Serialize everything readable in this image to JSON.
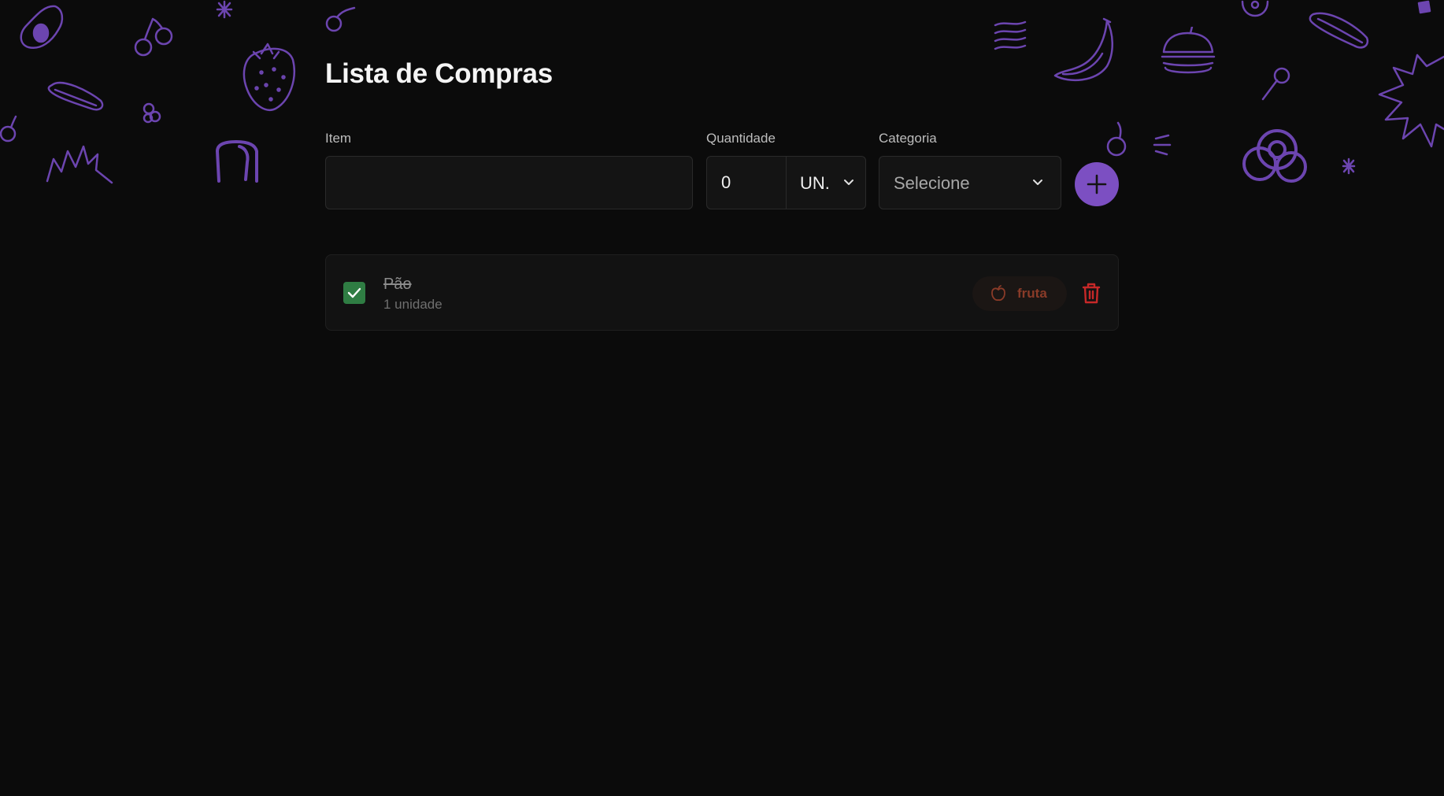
{
  "page": {
    "title": "Lista de Compras"
  },
  "form": {
    "item_label": "Item",
    "item_value": "",
    "quantity_label": "Quantidade",
    "quantity_value": "0",
    "unit_value": "UN.",
    "category_label": "Categoria",
    "category_value": "Selecione",
    "add_icon": "plus-icon"
  },
  "items": [
    {
      "name": "Pão",
      "quantity_text": "1 unidade",
      "checked": true,
      "category": "fruta",
      "category_icon": "apple-icon",
      "delete_icon": "trash-icon"
    }
  ],
  "colors": {
    "background": "#0b0b0b",
    "accent": "#7c4fc2",
    "checked": "#2f7d43",
    "delete": "#c62828",
    "badge_text": "#8a3b28",
    "doodle": "#6c45b0"
  }
}
